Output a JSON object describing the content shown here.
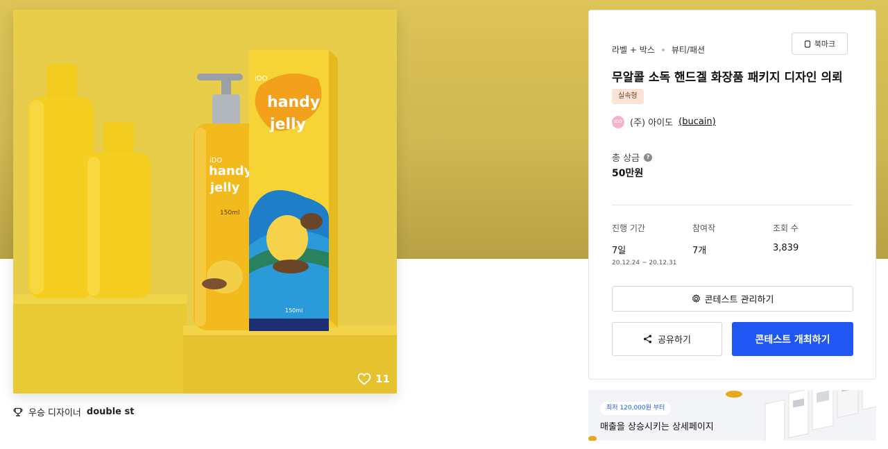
{
  "hero": {
    "box_brand": "handy jelly",
    "bottle_brand": "handy jelly",
    "bottle_volume": "150ml",
    "box_volume": "150ml",
    "box_logo": "iDO",
    "bottle_logo": "iDO",
    "like_icon": "heart-outline-icon",
    "like_count": "11"
  },
  "winner": {
    "icon": "trophy-icon",
    "label": "우승 디자이너",
    "name": "double st"
  },
  "panel": {
    "category": "라벨 + 박스",
    "subcategory": "뷰티/패션",
    "bookmark_label": "북마크",
    "title": "무알콜 소독 핸드겔 화장품 패키지 디자인 의뢰",
    "tag": "실속형",
    "owner_avatar": "IDO",
    "owner_name": "(주) 아이도",
    "owner_handle": "(bucain)",
    "prize_label": "총 상금",
    "prize_help": "?",
    "prize_value": "50만원",
    "stats": [
      {
        "label": "진행 기간",
        "value": "7일",
        "sub": "20.12.24 ~ 20.12.31"
      },
      {
        "label": "참여작",
        "value": "7개",
        "sub": ""
      },
      {
        "label": "조회 수",
        "value": "3,839",
        "sub": ""
      }
    ],
    "manage_label": "콘테스트 관리하기",
    "share_label": "공유하기",
    "host_label": "콘테스트 개최하기"
  },
  "ad": {
    "pill": "최저 120,000원 부터",
    "headline": "매출을 상승시키는 상세페이지"
  },
  "colors": {
    "accent": "#2057f2",
    "band": "#d4bc54",
    "product": "#f0c81e",
    "tag_bg": "#fbe3d6"
  }
}
